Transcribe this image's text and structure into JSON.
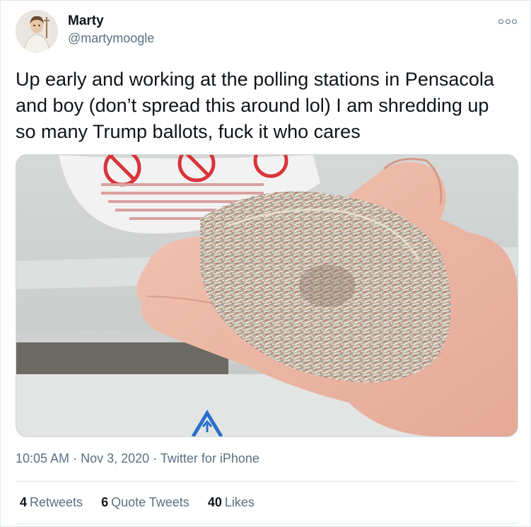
{
  "user": {
    "display_name": "Marty",
    "handle": "@martymoogle"
  },
  "tweet": {
    "text": "Up early and working at the polling stations in Pensacola and boy (don’t spread this around lol) I am shredding up so many Trump ballots, fuck it who cares",
    "time": "10:05 AM",
    "date": "Nov 3, 2020",
    "source": "Twitter for iPhone",
    "separator": "·"
  },
  "stats": [
    {
      "count": "4",
      "label": "Retweets"
    },
    {
      "count": "6",
      "label": "Quote Tweets"
    },
    {
      "count": "40",
      "label": "Likes"
    }
  ],
  "icons": {
    "more": "more-options-icon"
  },
  "colors": {
    "text": "#0f1419",
    "secondary": "#5b7083",
    "border": "#e1e8ed",
    "warning_red": "#d9343a",
    "warning_blue": "#2a6fc9"
  }
}
